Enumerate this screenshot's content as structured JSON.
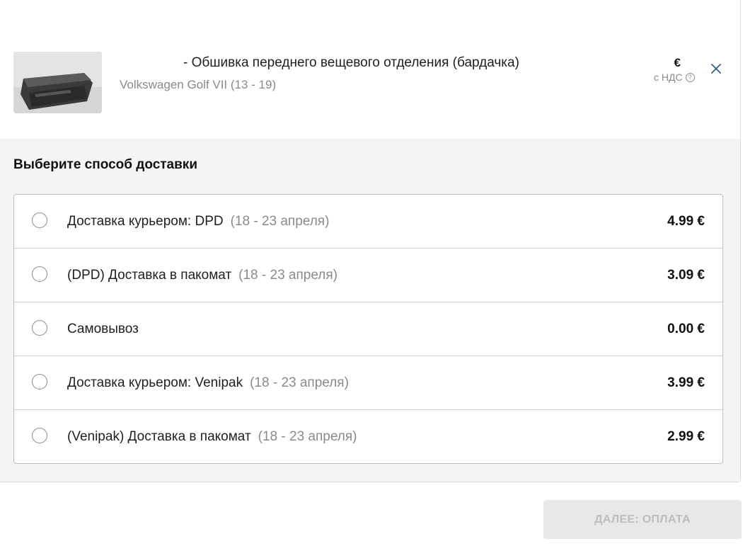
{
  "product": {
    "title": "- Обшивка переднего вещевого отделения (бардачка)",
    "vehicle": "Volkswagen Golf VII (13 - 19)",
    "price_currency": "€",
    "vat_note": "с НДС",
    "help_icon_glyph": "?",
    "remove_icon": "close-icon",
    "image": "glovebox-trim-photo"
  },
  "delivery": {
    "heading": "Выберите способ доставки",
    "options": [
      {
        "label": "Доставка курьером: DPD",
        "dates": "(18 - 23 апреля)",
        "price": "4.99 €",
        "selected": false
      },
      {
        "label": "(DPD) Доставка в пакомат",
        "dates": "(18 - 23 апреля)",
        "price": "3.09 €",
        "selected": false
      },
      {
        "label": "Самовывоз",
        "dates": "",
        "price": "0.00 €",
        "selected": false
      },
      {
        "label": "Доставка курьером: Venipak",
        "dates": "(18 - 23 апреля)",
        "price": "3.99 €",
        "selected": false
      },
      {
        "label": "(Venipak) Доставка в пакомат",
        "dates": "(18 - 23 апреля)",
        "price": "2.99 €",
        "selected": false
      }
    ]
  },
  "actions": {
    "next_label": "ДАЛЕЕ: ОПЛАТА",
    "next_enabled": false
  },
  "colors": {
    "section_background": "#f5f5f5",
    "button_disabled_bg": "#e8e8e8",
    "button_disabled_text": "#bdbdbd",
    "close_icon": "#2f5f8f",
    "muted_text": "#8a8a8a"
  }
}
